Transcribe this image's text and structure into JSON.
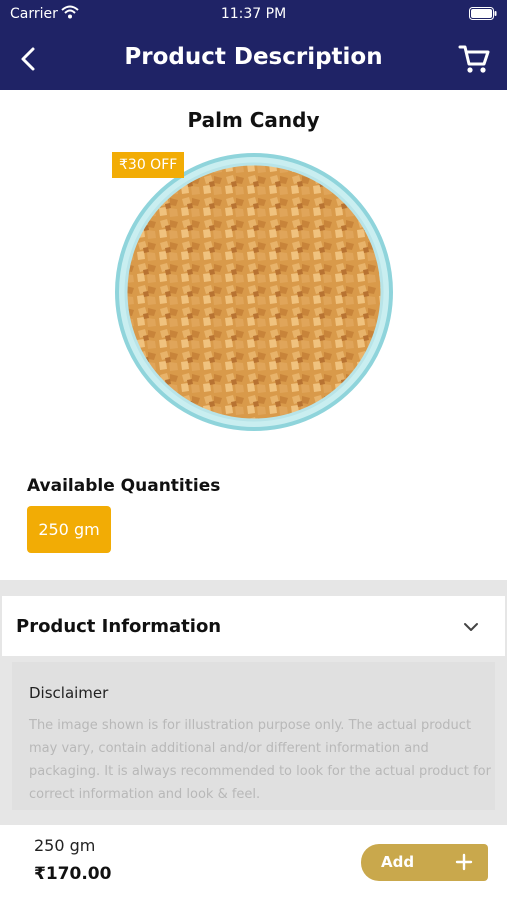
{
  "status_bar": {
    "carrier": "Carrier",
    "time": "11:37 PM"
  },
  "nav": {
    "title": "Product Description",
    "back_icon": "chevron-left-icon",
    "cart_icon": "shopping-cart-icon"
  },
  "product": {
    "name": "Palm Candy",
    "discount_badge": "₹30 OFF",
    "image": "palm-candy-bowl"
  },
  "quantities": {
    "heading": "Available Quantities",
    "options": [
      "250 gm"
    ],
    "selected": "250 gm"
  },
  "product_information": {
    "title": "Product Information",
    "expand_icon": "chevron-down-icon"
  },
  "disclaimer": {
    "title": "Disclaimer",
    "text": "The image shown is for illustration purpose only. The actual product may vary, contain additional and/or different information and packaging. It is always recommended to look for the actual product for correct information and look & feel."
  },
  "cart_bar": {
    "quantity": "250 gm",
    "price": "₹170.00",
    "add_label": "Add",
    "add_icon": "plus-icon"
  },
  "colors": {
    "header": "#1f2366",
    "accent": "#f2ac05",
    "add_button": "#c9a84c"
  }
}
